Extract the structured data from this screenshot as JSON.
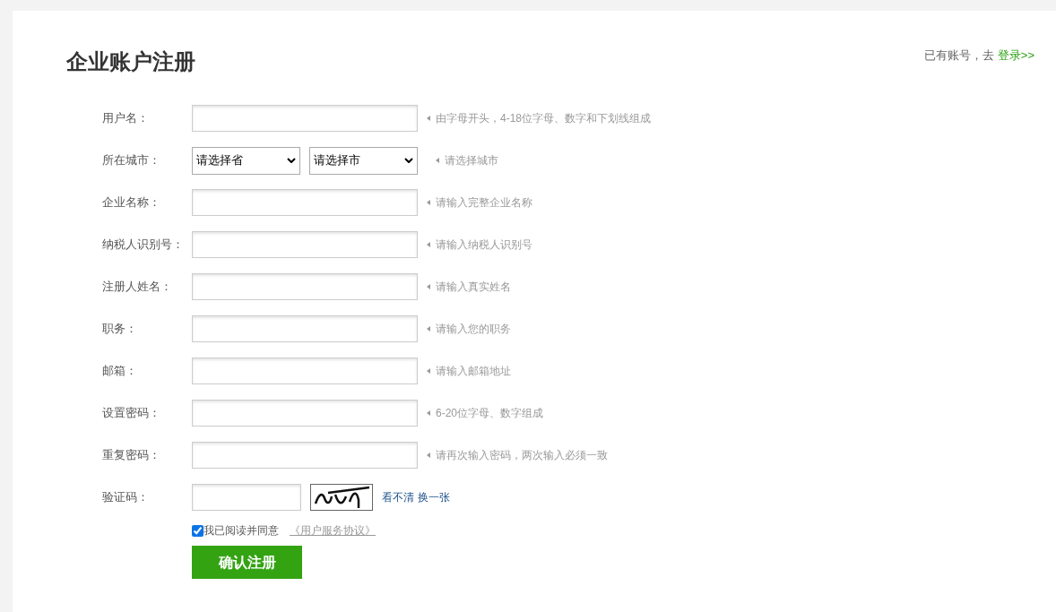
{
  "title": "企业账户注册",
  "login_prompt": {
    "text": "已有账号，去",
    "link": "登录>>"
  },
  "fields": [
    {
      "kind": "text",
      "label": "用户名：",
      "hint": "由字母开头，4-18位字母、数字和下划线组成"
    },
    {
      "kind": "selects",
      "label": "所在城市：",
      "selects": [
        "请选择省",
        "请选择市"
      ],
      "hint": "请选择城市"
    },
    {
      "kind": "text",
      "label": "企业名称：",
      "hint": "请输入完整企业名称"
    },
    {
      "kind": "text",
      "label": "纳税人识别号：",
      "hint": "请输入纳税人识别号"
    },
    {
      "kind": "text",
      "label": "注册人姓名：",
      "hint": "请输入真实姓名"
    },
    {
      "kind": "text",
      "label": "职务：",
      "hint": "请输入您的职务"
    },
    {
      "kind": "text",
      "label": "邮箱：",
      "hint": "请输入邮箱地址"
    },
    {
      "kind": "password",
      "label": "设置密码：",
      "hint": "6-20位字母、数字组成"
    },
    {
      "kind": "password",
      "label": "重复密码：",
      "hint": "请再次输入密码，两次输入必须一致"
    }
  ],
  "captcha": {
    "label": "验证码：",
    "unclear": "看不清",
    "refresh": "换一张"
  },
  "agreement": {
    "checked": true,
    "text": "我已阅读并同意",
    "link": "《用户服务协议》"
  },
  "submit": "确认注册"
}
